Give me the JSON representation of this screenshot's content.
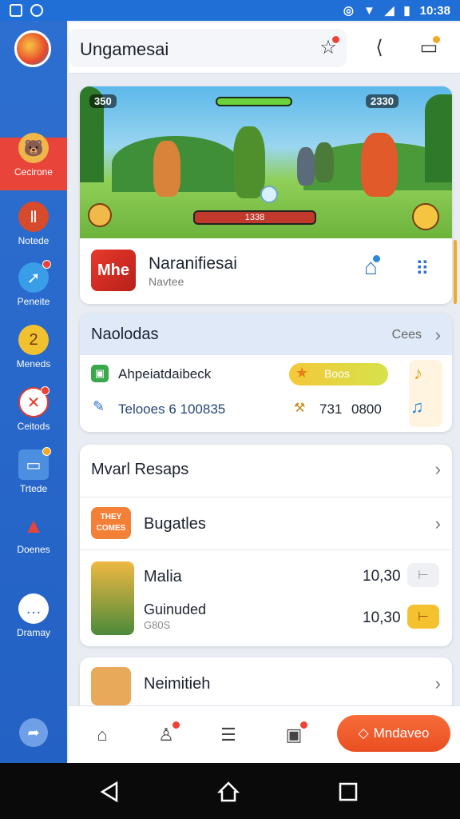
{
  "status": {
    "time": "10:38"
  },
  "app": {
    "title": "Ungamesai"
  },
  "sidebar": {
    "items": [
      {
        "label": "Cecirone"
      },
      {
        "label": "Notede"
      },
      {
        "label": "Peneite"
      },
      {
        "label": "Meneds"
      },
      {
        "label": "Ceitods"
      },
      {
        "label": "Trtede"
      },
      {
        "label": "Doenes"
      },
      {
        "label": "Dramay"
      }
    ]
  },
  "hero": {
    "score_left": "350",
    "score_right": "2330",
    "level_bar_text": "1338"
  },
  "featured": {
    "icon_text": "Mhe",
    "title": "Naranifiesai",
    "subtitle": "Navtee"
  },
  "section": {
    "title": "Naolodas",
    "more_label": "Cees",
    "row1_label": "Ahpeiatdaibeck",
    "row1_badge": "Boos",
    "row2_label": "Telooes 6 100835",
    "row2_value_a": "731",
    "row2_value_b": "0800"
  },
  "list": {
    "header": "Mvarl Resaps",
    "row_bugatles": {
      "label": "Bugatles",
      "thumb_text": "THEY COMES"
    },
    "row_malia": {
      "title": "Malia",
      "price": "10,30",
      "sub_title": "Guinuded",
      "sub_caption": "G80S",
      "sub_price": "10,30"
    },
    "row_neimitieh": {
      "label": "Neimitieh"
    }
  },
  "bottom": {
    "cta_label": "Mndaveo"
  }
}
